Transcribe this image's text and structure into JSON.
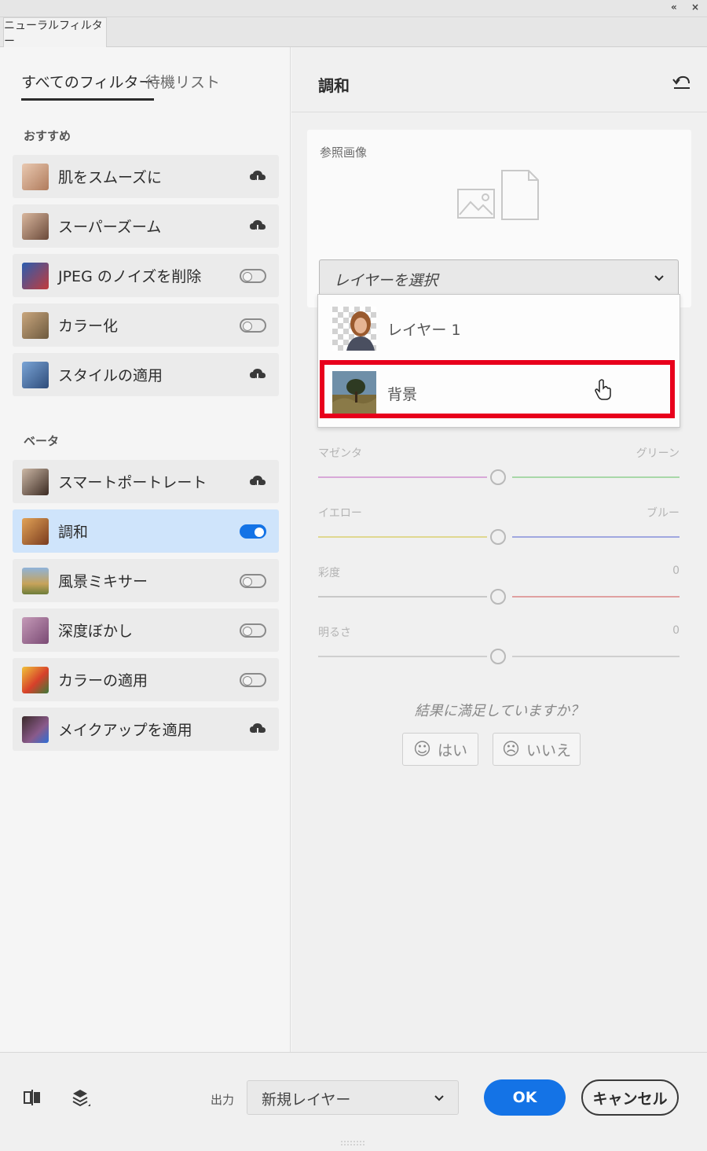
{
  "panel": {
    "tab_label": "ニューラルフィルター",
    "collapse_glyph": "«",
    "close_glyph": "×"
  },
  "left": {
    "tabs": [
      {
        "label": "すべてのフィルター",
        "active": true
      },
      {
        "label": "待機リスト",
        "active": false
      }
    ],
    "featured_label": "おすすめ",
    "beta_label": "ベータ",
    "featured": [
      {
        "label": "肌をスムーズに",
        "control": "cloud"
      },
      {
        "label": "スーパーズーム",
        "control": "cloud"
      },
      {
        "label": "JPEG のノイズを削除",
        "control": "toggle-off"
      },
      {
        "label": "カラー化",
        "control": "toggle-off"
      },
      {
        "label": "スタイルの適用",
        "control": "cloud"
      }
    ],
    "beta": [
      {
        "label": "スマートポートレート",
        "control": "cloud"
      },
      {
        "label": "調和",
        "control": "toggle-on",
        "selected": true
      },
      {
        "label": "風景ミキサー",
        "control": "toggle-off"
      },
      {
        "label": "深度ぼかし",
        "control": "toggle-off"
      },
      {
        "label": "カラーの適用",
        "control": "toggle-off"
      },
      {
        "label": "メイクアップを適用",
        "control": "cloud"
      }
    ]
  },
  "right": {
    "title": "調和",
    "reference_label": "参照画像",
    "layer_select": {
      "placeholder": "レイヤーを選択",
      "options": [
        "レイヤー 1",
        "背景"
      ],
      "hovered": "背景"
    },
    "sliders": [
      {
        "left": "マゼンタ",
        "right": "グリーン",
        "left_color": "#d8a8d8",
        "right_color": "#a8d8a8"
      },
      {
        "left": "イエロー",
        "right": "ブルー",
        "left_color": "#e0d890",
        "right_color": "#a0a8e0"
      },
      {
        "left": "彩度",
        "right": "0",
        "left_color": "#c8c8c8",
        "right_color": "#e0a0a0"
      },
      {
        "left": "明るさ",
        "right": "0",
        "left_color": "#cfcfcf",
        "right_color": "#cfcfcf"
      }
    ],
    "feedback": {
      "question": "結果に満足していますか？",
      "yes": "はい",
      "no": "いいえ",
      "yes_face": "☺",
      "no_face": "☹"
    }
  },
  "footer": {
    "output_label": "出力",
    "output_value": "新規レイヤー",
    "ok": "OK",
    "cancel": "キャンセル"
  },
  "colors": {
    "accent": "#1473e6",
    "highlight": "#e8001c",
    "selected_row": "#cfe4fb"
  }
}
